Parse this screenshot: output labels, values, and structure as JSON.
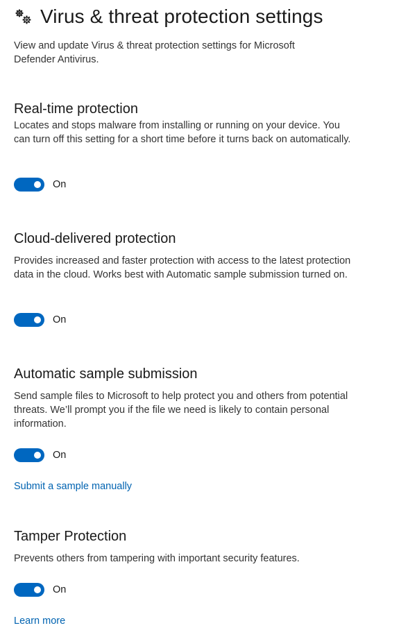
{
  "header": {
    "icon": "gear-icon",
    "title": "Virus & threat protection settings",
    "intro": "View and update Virus & threat protection settings for Microsoft Defender Antivirus."
  },
  "accent_color": "#0067c0",
  "link_color": "#0063b1",
  "sections": [
    {
      "title": "Real-time protection",
      "description": "Locates and stops malware from installing or running on your device. You can turn off this setting for a short time before it turns back on automatically.",
      "toggle": {
        "state": true,
        "label": "On"
      }
    },
    {
      "title": "Cloud-delivered protection",
      "description": "Provides increased and faster protection with access to the latest protection data in the cloud. Works best with Automatic sample submission turned on.",
      "toggle": {
        "state": true,
        "label": "On"
      }
    },
    {
      "title": "Automatic sample submission",
      "description": "Send sample files to Microsoft to help protect you and others from potential threats. We’ll prompt you if the file we need is likely to contain personal information.",
      "toggle": {
        "state": true,
        "label": "On"
      },
      "link": "Submit a sample manually"
    },
    {
      "title": "Tamper Protection",
      "description": "Prevents others from tampering with important security features.",
      "toggle": {
        "state": true,
        "label": "On"
      },
      "link": "Learn more"
    }
  ]
}
